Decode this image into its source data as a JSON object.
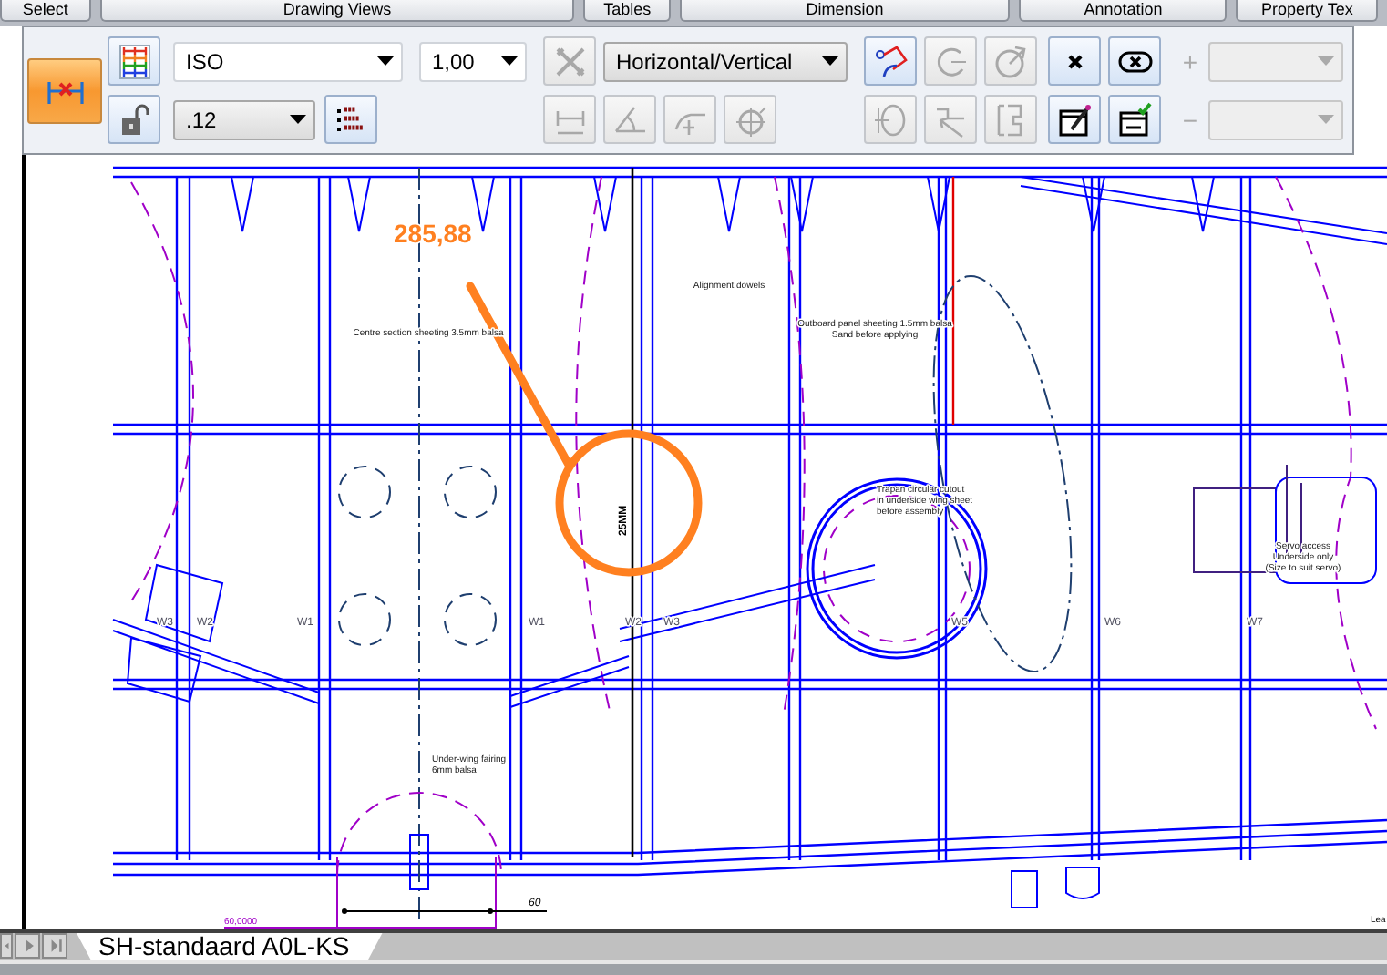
{
  "ribbon_tabs": [
    {
      "label": "Select",
      "selected": false
    },
    {
      "label": "Drawing Views",
      "selected": false
    },
    {
      "label": "Tables",
      "selected": false
    },
    {
      "label": "Dimension",
      "selected": false
    },
    {
      "label": "Annotation",
      "selected": false
    },
    {
      "label": "Property Tex",
      "selected": false
    }
  ],
  "toolbar": {
    "mode_button": {
      "selected": true
    },
    "rows": [
      {
        "controls": [
          {
            "kind": "button",
            "disabled": false
          },
          {
            "kind": "dropdown",
            "value": "ISO",
            "disabled": false
          },
          {
            "kind": "dropdown",
            "value": "1,00",
            "disabled": false
          },
          {
            "kind": "button",
            "disabled": true
          },
          {
            "kind": "dropdown",
            "value": "Horizontal/Vertical",
            "disabled": false
          },
          {
            "kind": "button",
            "disabled": false
          },
          {
            "kind": "button",
            "disabled": true
          },
          {
            "kind": "button",
            "disabled": true
          },
          {
            "kind": "button",
            "disabled": false
          },
          {
            "kind": "button",
            "disabled": false
          },
          {
            "kind": "sign",
            "text": "+",
            "disabled": true
          },
          {
            "kind": "dropdown",
            "disabled": true
          }
        ]
      },
      {
        "controls": [
          {
            "kind": "button",
            "disabled": false
          },
          {
            "kind": "dropdown",
            "value": ".12",
            "disabled": false
          },
          {
            "kind": "button",
            "disabled": false
          },
          {
            "kind": "button",
            "disabled": true
          },
          {
            "kind": "button",
            "disabled": true
          },
          {
            "kind": "button",
            "disabled": true
          },
          {
            "kind": "button",
            "disabled": true
          },
          {
            "kind": "button",
            "disabled": true
          },
          {
            "kind": "button",
            "disabled": true
          },
          {
            "kind": "button",
            "disabled": true
          },
          {
            "kind": "button",
            "disabled": false
          },
          {
            "kind": "button",
            "disabled": false
          },
          {
            "kind": "sign",
            "text": "−",
            "disabled": true
          },
          {
            "kind": "dropdown",
            "disabled": true
          }
        ]
      }
    ]
  },
  "drawing": {
    "dimension_callout": "285,88",
    "vertical_dimension": "25MM",
    "notes": [
      {
        "lines": [
          "Centre section sheeting 3.5mm balsa"
        ]
      },
      {
        "lines": [
          "Alignment dowels"
        ]
      },
      {
        "lines": [
          "Outboard panel sheeting 1.5mm balsa",
          "Sand before applying"
        ]
      },
      {
        "lines": [
          "Trapan circular cutout",
          "in underside wing sheet",
          "before assembly"
        ]
      },
      {
        "lines": [
          "Servo access",
          "Underside only",
          "(Size to suit servo)"
        ]
      },
      {
        "lines": [
          "Under-wing fairing",
          "6mm balsa"
        ]
      }
    ],
    "web_labels": [
      "W3",
      "W2",
      "W1",
      "W1",
      "W2",
      "W3",
      "W5",
      "W6",
      "W7"
    ],
    "bottom_dimension": "60",
    "bottom_reading": "60,0000",
    "edge_text": "Lea"
  },
  "sheet_tabs": [
    {
      "label": "SH-standaard A0L-KS",
      "selected": true
    }
  ]
}
